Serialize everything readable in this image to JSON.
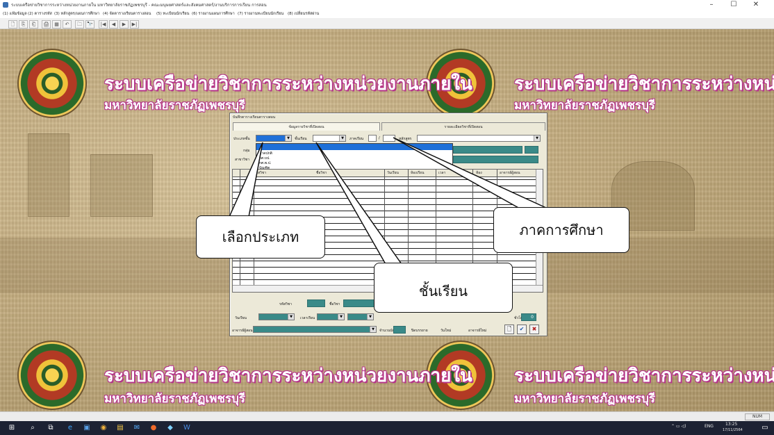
{
  "window": {
    "title": "ระบบเครือข่ายวิชาการระหว่างหน่วยงานภายใน มหาวิทยาลัยราชภัฏเพชรบุรี - คณะมนุษยศาสตร์และสังคมศาสตร์/งานบริการการเรียน การสอน",
    "min": "–",
    "max": "☐",
    "close": "✕"
  },
  "menu": [
    "(1) แฟ้มข้อมูล",
    "(2) ตารางรหัส",
    "(3) หลักสูตร/แผนการศึกษา",
    "(4) จัดตารางเรียนตารางสอน",
    "(5) ทะเบียนนักเรียน",
    "(6) รายงานแผนการศึกษา",
    "(7) รายงานทะเบียนนักเรียน",
    "(8) เปลี่ยนรหัสผ่าน"
  ],
  "toolbar": [
    "🗋",
    "⎘",
    "⎗",
    "🖨",
    "▦",
    "↶",
    "🗀",
    "🔭",
    "|◀",
    "◀",
    "▶",
    "▶|"
  ],
  "banner": {
    "title": "ระบบเครือข่ายวิชาการระหว่างหน่วยงานภายใน",
    "subtitle": "มหาวิทยาลัยราชภัฏเพชรบุรี"
  },
  "dialog": {
    "title": "บันทึกตารางเรียนตารางสอน",
    "tabs": [
      "ข้อมูลรายวิชาที่เปิดสอน",
      "รายละเอียดวิชาที่เปิดสอน"
    ],
    "type_label": "ประเภทชั้น",
    "class_label": "ชั้นเรียน",
    "term_label": "ภาคเรียน",
    "term_sep": "/",
    "curriculum_label": "หลักสูตร",
    "group_label": "กลุ่ม",
    "program_label": "สาขาวิชา",
    "dropdown_options": [
      "ภาคปกติ",
      "กศ.บป.",
      "กศ.พ.ป.",
      "บัณฑิต"
    ],
    "grid_headers": [
      "รหัสวิชา",
      "ชื่อวิชา",
      "วันเรียน",
      "ห้องเรียน",
      "เวลา",
      "ห้อง",
      "อาจารย์ผู้สอน"
    ],
    "course_code_label": "รหัสวิชา",
    "course_name_label": "ชื่อวิชา",
    "day_label": "วันเรียน",
    "time_label": "เวลาเรียน",
    "hours_label": "ชั่วโมง",
    "teacher_label": "อาจารย์ผู้สอน",
    "students_label": "จำนวนนักศึกษา",
    "hours_value": "0",
    "radio_options": [
      "ปิดบรรยาย",
      "วันใหม่",
      "อาจารย์ใหม่"
    ],
    "btn_new": "🗋",
    "btn_save": "✔",
    "btn_cancel": "✖"
  },
  "callouts": {
    "type": "เลือกประเภท",
    "term": "ภาคการศึกษา",
    "class": "ชั้นเรียน"
  },
  "statusbar": {
    "num": "NUM"
  },
  "taskbar": {
    "tray_lang": "ENG",
    "time": "13:25",
    "date": "17/11/2564"
  }
}
